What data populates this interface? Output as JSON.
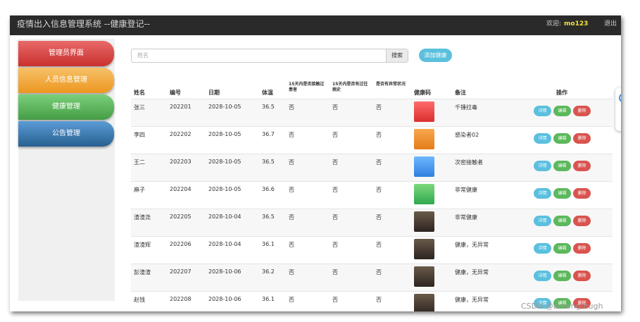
{
  "app": {
    "title": "疫情出入信息管理系统 --健康登记--",
    "welcome_label": "欢迎:",
    "username": "mo123",
    "logout": "退出"
  },
  "sidebar": {
    "items": [
      {
        "label": "管理员界面",
        "color": "#d9534f"
      },
      {
        "label": "人员信息管理",
        "color": "#f0ad4e"
      },
      {
        "label": "健康管理",
        "color": "#5cb85c"
      },
      {
        "label": "公告管理",
        "color": "#337ab7"
      }
    ]
  },
  "search": {
    "placeholder": "姓名",
    "button": "搜索"
  },
  "add_button": "添加健康",
  "table": {
    "headers": [
      "姓名",
      "编号",
      "日期",
      "体温",
      "15天内是否接触过患者",
      "15天内是否有过往病史",
      "是否有异常状况",
      "健康码",
      "备注",
      "操作"
    ],
    "actions": [
      "详情",
      "编辑",
      "删除"
    ],
    "rows": [
      {
        "name": "张三",
        "id": "202201",
        "date": "2028-10-05",
        "temp": "36.5",
        "contact": "否",
        "history": "否",
        "abnormal": "否",
        "code_icon": "health-code-red",
        "note": "千锤拉毒"
      },
      {
        "name": "李四",
        "id": "202202",
        "date": "2028-10-05",
        "temp": "36.7",
        "contact": "否",
        "history": "否",
        "abnormal": "否",
        "code_icon": "health-code-orange",
        "note": "感染者02"
      },
      {
        "name": "王二",
        "id": "202203",
        "date": "2028-10-05",
        "temp": "36.5",
        "contact": "否",
        "history": "否",
        "abnormal": "否",
        "code_icon": "health-code-blue",
        "note": "次密接触者"
      },
      {
        "name": "麻子",
        "id": "202204",
        "date": "2028-10-05",
        "temp": "36.6",
        "contact": "否",
        "history": "否",
        "abnormal": "否",
        "code_icon": "health-code-green",
        "note": "非常健康"
      },
      {
        "name": "渣渣尧",
        "id": "202205",
        "date": "2028-10-04",
        "temp": "36.5",
        "contact": "否",
        "history": "否",
        "abnormal": "否",
        "code_icon": "photo-portrait",
        "note": "非常健康"
      },
      {
        "name": "渣渣辉",
        "id": "202206",
        "date": "2028-10-04",
        "temp": "36.1",
        "contact": "否",
        "history": "否",
        "abnormal": "否",
        "code_icon": "photo-portrait",
        "note": "健康，无异常"
      },
      {
        "name": "彭渣渣",
        "id": "202207",
        "date": "2028-10-06",
        "temp": "36.2",
        "contact": "否",
        "history": "否",
        "abnormal": "否",
        "code_icon": "photo-portrait",
        "note": "健康，无异常"
      },
      {
        "name": "赵钱",
        "id": "202208",
        "date": "2028-10-06",
        "temp": "36.1",
        "contact": "否",
        "history": "否",
        "abnormal": "否",
        "code_icon": "photo-portrait",
        "note": "健康，无异常"
      }
    ]
  },
  "watermark": "CSDN @antong-hugh"
}
